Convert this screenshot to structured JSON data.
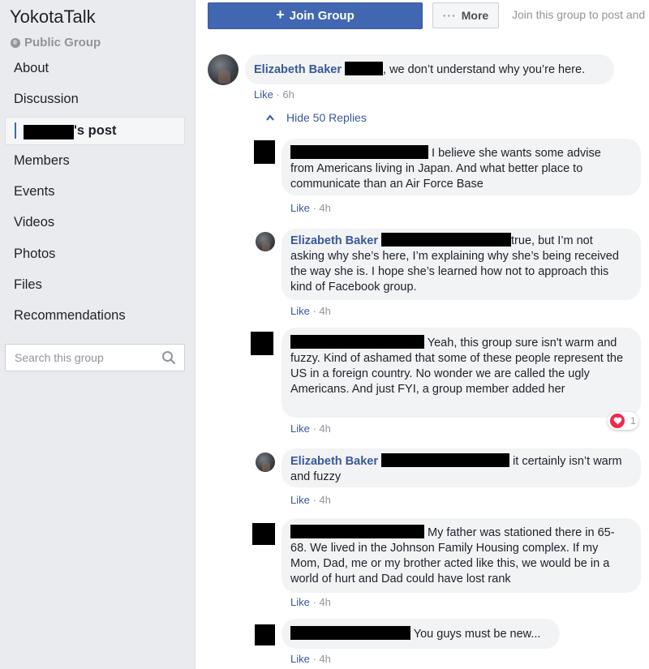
{
  "sidebar": {
    "group_name": "YokotaTalk",
    "privacy": "Public Group",
    "items": [
      {
        "label": "About"
      },
      {
        "label": "Discussion"
      },
      {
        "label": "'s post"
      },
      {
        "label": "Members"
      },
      {
        "label": "Events"
      },
      {
        "label": "Videos"
      },
      {
        "label": "Photos"
      },
      {
        "label": "Files"
      },
      {
        "label": "Recommendations"
      }
    ],
    "search_placeholder": "Search this group"
  },
  "header": {
    "join_label": "Join Group",
    "more_label": "More",
    "join_prompt": "Join this group to post and"
  },
  "thread": {
    "top": {
      "author": "Elizabeth Baker",
      "text": ", we don’t understand why you’re here.",
      "like": "Like",
      "time": "6h"
    },
    "hide_replies": "Hide 50 Replies",
    "replies": [
      {
        "author": "",
        "line1": "I believe she wants some advise",
        "rest": "from Americans living in Japan. And what better place to communicate than an Air Force Base",
        "like": "Like",
        "time": "4h"
      },
      {
        "author": "Elizabeth Baker",
        "line1": "true, but I’m not",
        "rest": "asking why she’s here, I’m explaining why she’s being received the way she is. I hope she’s learned how not to approach this kind of Facebook group.",
        "like": "Like",
        "time": "4h"
      },
      {
        "author": "",
        "line1": "Yeah, this group sure isn't warm",
        "rest": "and fuzzy. Kind of ashamed that some of these people represent the US in a foreign country. No wonder we are called the ugly Americans. And just FYI, a group member added her",
        "like": "Like",
        "time": "4h",
        "reactions": "1"
      },
      {
        "author": "Elizabeth Baker",
        "line1": "it certainly isn’t",
        "rest": "warm and fuzzy",
        "like": "Like",
        "time": "4h"
      },
      {
        "author": "",
        "line1": "My father was stationed there in 65-",
        "rest": "68. We lived in the Johnson Family Housing complex. If my Mom, Dad, me or my brother acted like this, we would be in a world of hurt and Dad could have lost rank",
        "like": "Like",
        "time": "4h"
      },
      {
        "author": "",
        "line1": "You guys must be new...",
        "rest": "",
        "like": "Like",
        "time": "4h"
      }
    ]
  },
  "colors": {
    "brand": "#4267b2",
    "link": "#385898",
    "bubble": "#f2f3f5",
    "sidebar_bg": "#e9ebee",
    "heart": "#f0284a"
  }
}
